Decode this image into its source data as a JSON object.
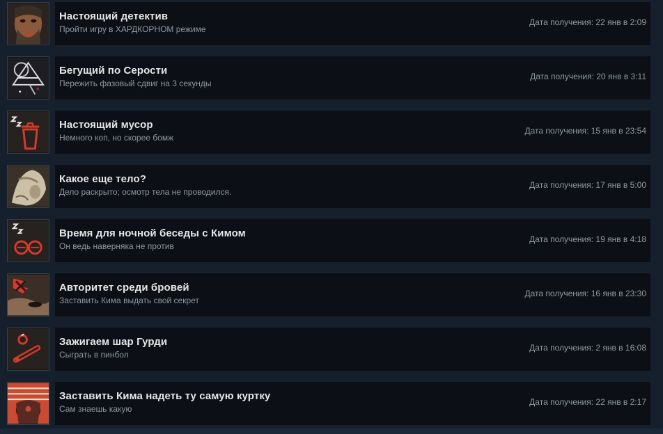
{
  "achievements": [
    {
      "title": "Настоящий детектив",
      "description": "Пройти игру в ХАРДКОРНОМ режиме",
      "date": "Дата получения: 22 янв в 2:09",
      "icon": "detective-portrait-icon"
    },
    {
      "title": "Бегущий по Серости",
      "description": "Пережить фазовый сдвиг на 3 секунды",
      "date": "Дата получения: 20 янв в 3:11",
      "icon": "pale-sigil-icon"
    },
    {
      "title": "Настоящий мусор",
      "description": "Немного коп, но скорее бомж",
      "date": "Дата получения: 15 янв в 23:54",
      "icon": "trash-can-icon"
    },
    {
      "title": "Какое еще тело?",
      "description": "Дело раскрыто; осмотр тела не проводился.",
      "date": "Дата получения: 17 янв в 5:00",
      "icon": "hanged-body-icon"
    },
    {
      "title": "Время для ночной беседы с Кимом",
      "description": "Он ведь наверняка не против",
      "date": "Дата получения: 19 янв в 4:18",
      "icon": "sleeping-glasses-icon"
    },
    {
      "title": "Авторитет среди бровей",
      "description": "Заставить Кима выдать свой секрет",
      "date": "Дата получения: 16 янв в 23:30",
      "icon": "angry-brow-icon"
    },
    {
      "title": "Зажигаем шар Гурди",
      "description": "Сыграть в пинбол",
      "date": "Дата получения: 2 янв в 16:08",
      "icon": "pinball-flipper-icon"
    },
    {
      "title": "Заставить Кима надеть ту самую куртку",
      "description": "Сам знаешь какую",
      "date": "Дата получения: 22 янв в 2:17",
      "icon": "jacket-icon"
    }
  ]
}
